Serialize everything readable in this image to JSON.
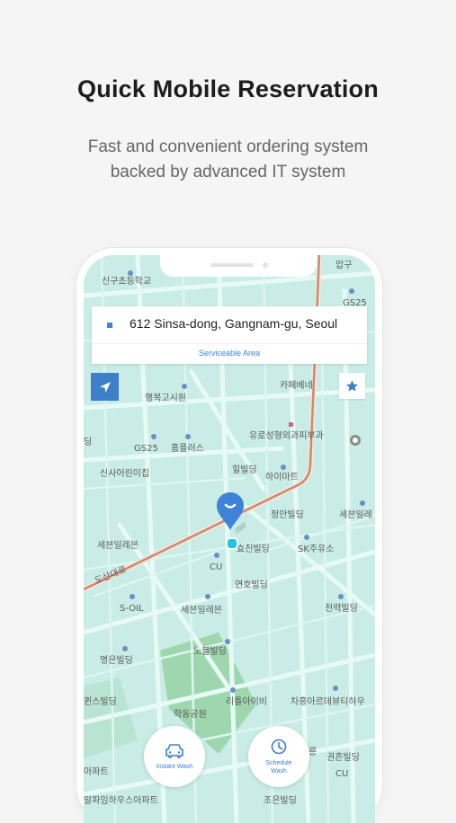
{
  "promo": {
    "title": "Quick Mobile Reservation",
    "subtitle_line1": "Fast and convenient ordering system",
    "subtitle_line2": "backed by advanced IT system"
  },
  "address_card": {
    "address": "612 Sinsa-dong, Gangnam-gu, Seoul",
    "area_label": "Serviceable Area"
  },
  "map_labels": [
    {
      "text": "신구초등학교"
    },
    {
      "text": "압구"
    },
    {
      "text": "GS25"
    },
    {
      "text": "카페베네"
    },
    {
      "text": "행복고시원"
    },
    {
      "text": "유로성형외과피부과"
    },
    {
      "text": "GS25"
    },
    {
      "text": "홈플러스"
    },
    {
      "text": "힐빌딩"
    },
    {
      "text": "하이마트"
    },
    {
      "text": "신사어린이집"
    },
    {
      "text": "정안빌딩"
    },
    {
      "text": "세븐일레"
    },
    {
      "text": "세븐일레븐"
    },
    {
      "text": "효진빌딩"
    },
    {
      "text": "SK주유소"
    },
    {
      "text": "CU"
    },
    {
      "text": "도산대로"
    },
    {
      "text": "연호빌딩"
    },
    {
      "text": "S-OIL"
    },
    {
      "text": "세븐일레븐"
    },
    {
      "text": "천력빌딩"
    },
    {
      "text": "명은빌딩"
    },
    {
      "text": "노블빌딩"
    },
    {
      "text": "퀸스빌딩"
    },
    {
      "text": "리틀아이비"
    },
    {
      "text": "차홍아르데뷰티하우"
    },
    {
      "text": "학동공원"
    },
    {
      "text": "권흔빌딩"
    },
    {
      "text": "아파트"
    },
    {
      "text": "CU"
    },
    {
      "text": "알파임하우스아파트"
    },
    {
      "text": "조은빌딩"
    },
    {
      "text": "릉"
    },
    {
      "text": "딩"
    }
  ],
  "buttons": {
    "instant_wash": "Instant Wash",
    "schedule_line1": "Schedule",
    "schedule_line2": "Wash"
  },
  "icons": {
    "locate": "navigation-arrow-icon",
    "favorite": "star-icon",
    "pin": "location-pin-icon",
    "car": "car-icon",
    "clock": "clock-icon"
  },
  "colors": {
    "map_bg": "#c9ece6",
    "road": "#e8faf6",
    "main_road": "#c98a6e",
    "accent": "#3d84d8",
    "park": "#8fcf9a"
  }
}
